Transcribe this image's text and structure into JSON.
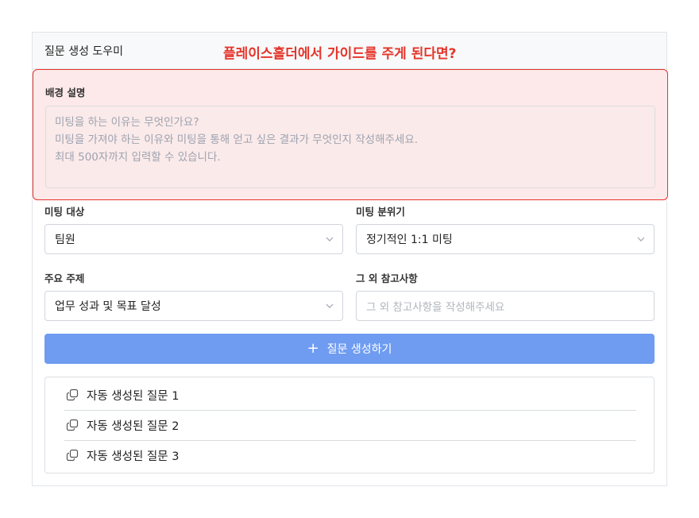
{
  "header": {
    "title": "질문 생성 도우미",
    "annotation": "플레이스홀더에서 가이드를 주게 된다면?"
  },
  "background": {
    "label": "배경 설명",
    "placeholder": "미팅을 하는 이유는 무엇인가요?\n미팅을 가져야 하는 이유와 미팅을 통해 얻고 싶은 결과가 무엇인지 작성해주세요.\n최대 500자까지 입력할 수 있습니다."
  },
  "target": {
    "label": "미팅 대상",
    "value": "팀원"
  },
  "mood": {
    "label": "미팅 분위기",
    "value": "정기적인 1:1 미팅"
  },
  "topic": {
    "label": "주요 주제",
    "value": "업무 성과 및 목표 달성"
  },
  "notes": {
    "label": "그 외 참고사항",
    "placeholder": "그 외 참고사항을 작성해주세요"
  },
  "generate": {
    "icon": "plus-icon",
    "label": "질문 생성하기"
  },
  "results": {
    "icon": "copy-icon",
    "items": [
      "자동 생성된 질문 1",
      "자동 생성된 질문 2",
      "자동 생성된 질문 3"
    ]
  },
  "colors": {
    "accent": "#6f9cf1",
    "annotation": "#e5352b",
    "highlight_bg": "#fde9e9"
  }
}
